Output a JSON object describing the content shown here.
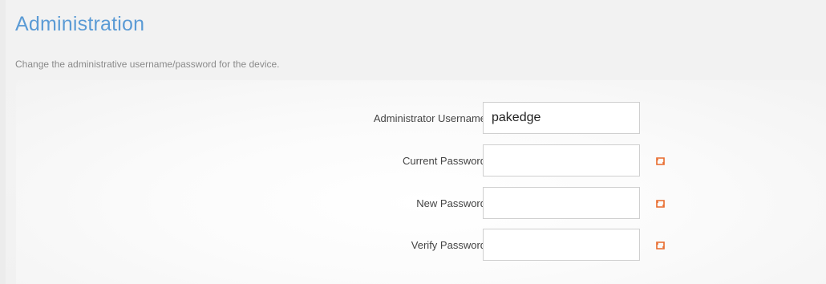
{
  "page": {
    "title": "Administration",
    "subtitle": "Change the administrative username/password for the device."
  },
  "form": {
    "username": {
      "label": "Administrator Username",
      "value": "pakedge"
    },
    "current_password": {
      "label": "Current Password",
      "value": "",
      "required_icon": "required-field-icon"
    },
    "new_password": {
      "label": "New Password",
      "value": "",
      "required_icon": "required-field-icon"
    },
    "verify_password": {
      "label": "Verify Password",
      "value": "",
      "required_icon": "required-field-icon"
    }
  },
  "colors": {
    "title": "#5b9bd5",
    "required_icon": "#e8692a"
  }
}
